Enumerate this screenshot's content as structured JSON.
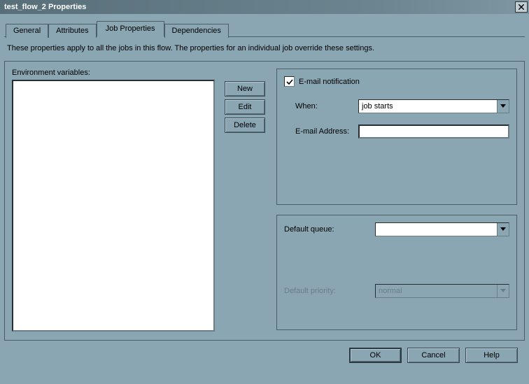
{
  "window": {
    "title": "test_flow_2 Properties"
  },
  "tabs": {
    "general": "General",
    "attributes": "Attributes",
    "job_properties": "Job Properties",
    "dependencies": "Dependencies"
  },
  "description": "These properties apply to all the jobs in this flow. The properties for an individual job override these settings.",
  "env": {
    "label": "Environment variables:"
  },
  "buttons": {
    "new": "New",
    "edit": "Edit",
    "delete": "Delete",
    "ok": "OK",
    "cancel": "Cancel",
    "help": "Help"
  },
  "email": {
    "checkbox_label": "E-mail notification",
    "checked": true,
    "when_label": "When:",
    "when_value": "job starts",
    "address_label": "E-mail Address:",
    "address_value": ""
  },
  "queue": {
    "label": "Default queue:",
    "value": "",
    "priority_label": "Default priority:",
    "priority_value": "normal"
  }
}
